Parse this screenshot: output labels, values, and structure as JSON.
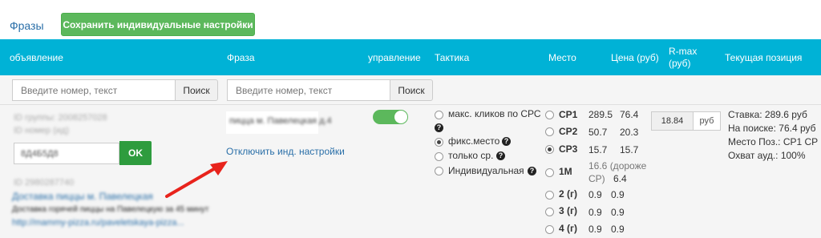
{
  "topbar": {
    "phrases_label": "Фразы",
    "save_button": "Сохранить индивидуальные настройки"
  },
  "header": {
    "col_ad": "объявление",
    "col_phrase": "Фраза",
    "col_control": "управление",
    "col_tactics": "Тактика",
    "col_place": "Место",
    "col_price": "Цена (руб)",
    "col_rmax_1": "R-max",
    "col_rmax_2": "(руб)",
    "col_current": "Текущая позиция"
  },
  "filters": {
    "ad_placeholder": "Введите номер, текст",
    "ad_search": "Поиск",
    "phrase_placeholder": "Введите номер, текст",
    "phrase_search": "Поиск"
  },
  "row": {
    "ad": {
      "group_id": "ID группы: 2008257028",
      "ad_id": "ID номер (ид)",
      "bid_value": "8Д4Б5Д8",
      "ok": "OK",
      "campaign_id": "ID 2980287740",
      "title": "Доставка пиццы м. Павелецкая",
      "text": "Доставка горячей пиццы на Павелецкую за 45 минут",
      "url": "http://mammy-pizza.ru/paveletskaya-pizza..."
    },
    "phrase": {
      "text": "пицца м. Павелецкая д.4",
      "disable_link": "Отключить инд. настройки"
    },
    "control": {
      "enabled": true
    },
    "tactics": [
      {
        "label": "макс. кликов по СРС",
        "selected": false,
        "help": "?"
      },
      {
        "label": "фикс.место",
        "selected": true,
        "help": "?"
      },
      {
        "label": "только ср.",
        "selected": false,
        "help": "?"
      },
      {
        "label": "Индивидуальная",
        "selected": false,
        "help": "?"
      }
    ],
    "places": [
      {
        "label": "СР1",
        "selected": false,
        "price_a": "289.5",
        "price_b": "76.4"
      },
      {
        "label": "СР2",
        "selected": false,
        "price_a": "50.7",
        "price_b": "20.3"
      },
      {
        "label": "СР3",
        "selected": true,
        "price_a": "15.7",
        "price_b": "15.7"
      },
      {
        "label": "1М",
        "selected": false,
        "note_1": "16.6 (дороже",
        "note_2": "СР)",
        "price_b": "6.4"
      },
      {
        "label": "2 (г)",
        "selected": false,
        "price_a": "0.9",
        "price_b": "0.9"
      },
      {
        "label": "3 (г)",
        "selected": false,
        "price_a": "0.9",
        "price_b": "0.9"
      },
      {
        "label": "4 (г)",
        "selected": false,
        "price_a": "0.9",
        "price_b": "0.9"
      }
    ],
    "rmax": {
      "value": "18.84",
      "unit": "руб"
    },
    "current": {
      "bid": "Ставка: 289.6 руб",
      "search": "На поиске: 76.4 руб",
      "place": "Место Поз.: СР1 СР",
      "reach": "Охват ауд.: 100%"
    }
  },
  "colors": {
    "header_bg": "#00b2d6",
    "save_btn": "#5cb85c",
    "ok_btn": "#2e9c3e",
    "link": "#2a6fa8",
    "arrow": "#e8231c"
  }
}
